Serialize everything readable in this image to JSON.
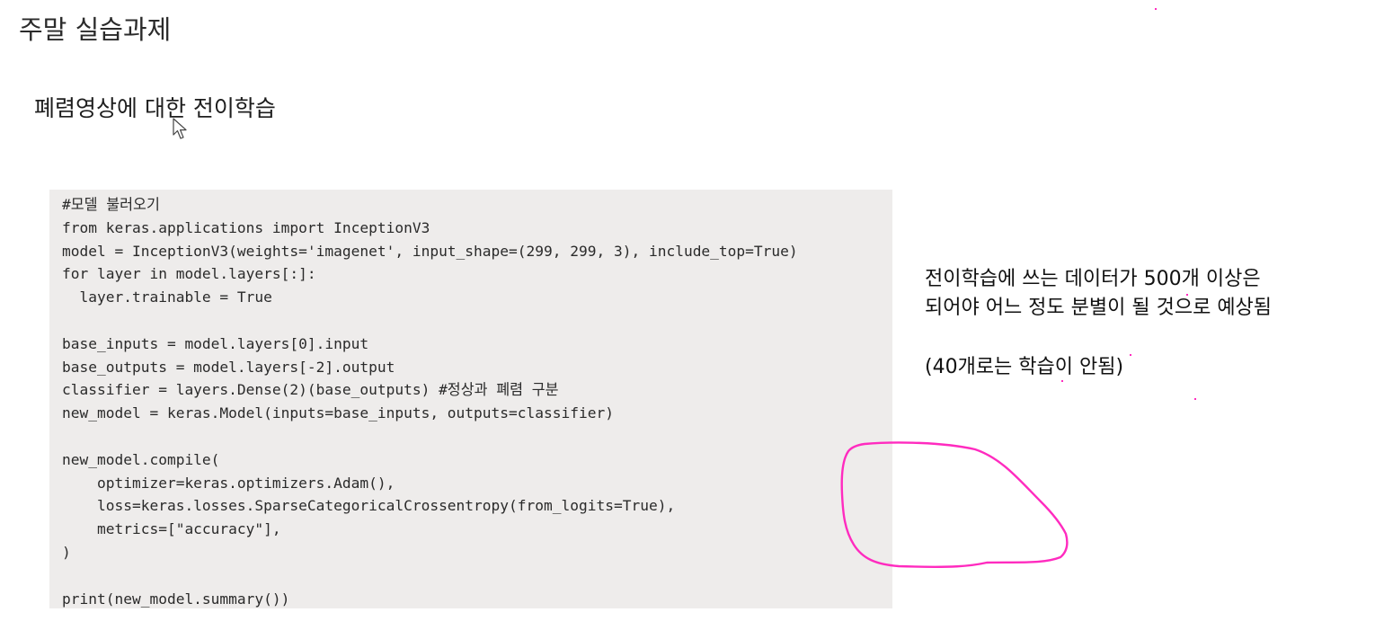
{
  "slide": {
    "title": "주말 실습과제",
    "subtitle": "폐렴영상에 대한 전이학습"
  },
  "code": {
    "lines": [
      "#모델 불러오기",
      "from keras.applications import InceptionV3",
      "model = InceptionV3(weights='imagenet', input_shape=(299, 299, 3), include_top=True)",
      "for layer in model.layers[:]:",
      "  layer.trainable = True",
      "",
      "base_inputs = model.layers[0].input",
      "base_outputs = model.layers[-2].output",
      "classifier = layers.Dense(2)(base_outputs) #정상과 폐렴 구분",
      "new_model = keras.Model(inputs=base_inputs, outputs=classifier)",
      "",
      "new_model.compile(",
      "    optimizer=keras.optimizers.Adam(),",
      "    loss=keras.losses.SparseCategoricalCrossentropy(from_logits=True),",
      "    metrics=[\"accuracy\"],",
      ")",
      "",
      "print(new_model.summary())"
    ]
  },
  "notes": {
    "line1": "전이학습에 쓰는 데이터가 500개 이상은",
    "line2": "되어야 어느 정도 분별이 될 것으로 예상됨",
    "line3": "(40개로는 학습이 안됨)"
  },
  "colors": {
    "code_background": "#eeeceb",
    "annotation_ink": "#ff2bbf"
  },
  "icons": {
    "cursor": "mouse-pointer-icon"
  }
}
